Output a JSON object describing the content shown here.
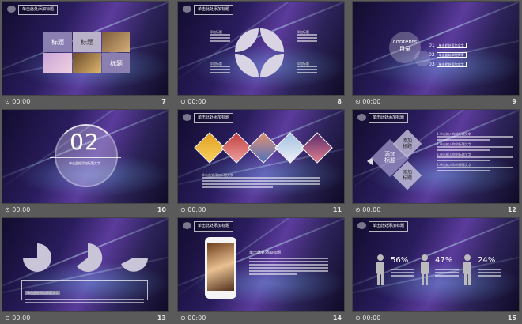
{
  "slides": [
    {
      "num": "7",
      "time": "00:00",
      "title": "单击此处添加标题",
      "tiles": [
        "标题",
        "标题",
        "标题"
      ]
    },
    {
      "num": "8",
      "time": "00:00",
      "title": "单击此处添加标题",
      "labels": [
        "添加标题",
        "添加标题",
        "添加标题",
        "添加标题"
      ]
    },
    {
      "num": "9",
      "time": "00:00",
      "title": "单击此处添加标题",
      "circle_en": "contents",
      "circle_cn": "目录",
      "items": [
        {
          "n": "01",
          "t": "单击此处添加文字"
        },
        {
          "n": "02",
          "t": "单击此处添加文字"
        },
        {
          "n": "03",
          "t": "单击此处添加文字"
        }
      ]
    },
    {
      "num": "10",
      "time": "00:00",
      "big": "02",
      "sub": "单击此处添加标题文字"
    },
    {
      "num": "11",
      "time": "00:00",
      "title": "单击此处添加标题",
      "caption": "单击此处添加标题文字"
    },
    {
      "num": "12",
      "time": "00:00",
      "title": "单击此处添加标题",
      "diamonds": [
        "添加\n标题",
        "添加\n标题",
        "添加\n标题"
      ],
      "points": [
        "1.单击输入你的标题文字",
        "2.单击输入你的标题文字",
        "3.单击输入你的标题文字",
        "4.单击输入你的标题文字"
      ]
    },
    {
      "num": "13",
      "time": "00:00",
      "box_title": "单击此处添加标题文字"
    },
    {
      "num": "14",
      "time": "00:00",
      "title": "单击此处添加标题",
      "heading": "单击此处添加标题"
    },
    {
      "num": "15",
      "time": "00:00",
      "title": "单击此处添加标题",
      "pcts": [
        "56%",
        "47%",
        "24%"
      ]
    }
  ],
  "time_prefix": "⊙"
}
